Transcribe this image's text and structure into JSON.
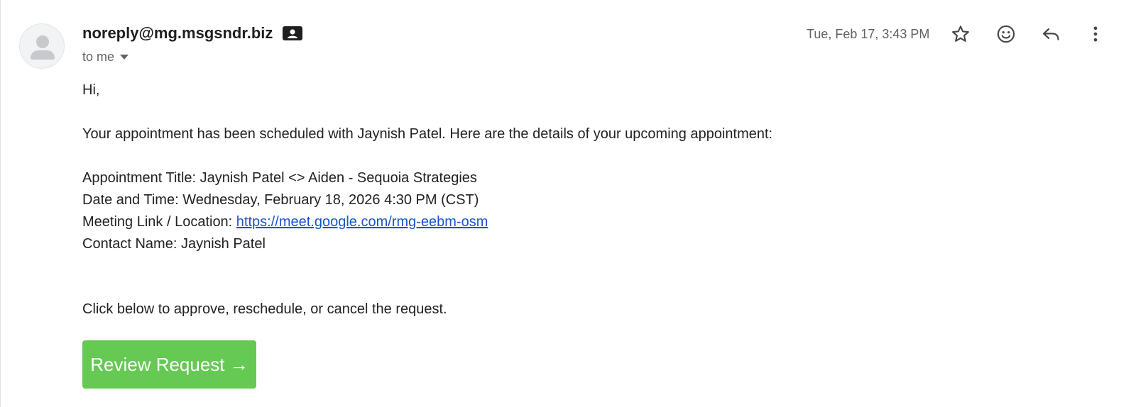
{
  "sender": {
    "email": "noreply@mg.msgsndr.biz",
    "contact_icon": "contact-card-icon"
  },
  "recipient": {
    "label": "to me",
    "dropdown_icon": "chevron-down-icon"
  },
  "header": {
    "timestamp": "Tue, Feb 17, 3:43 PM",
    "icons": [
      "star-icon",
      "emoji-icon",
      "reply-icon",
      "more-vert-icon"
    ]
  },
  "message": {
    "greeting": "Hi,",
    "intro": "Your appointment has been scheduled with Jaynish Patel. Here are the details of your upcoming appointment:",
    "details": {
      "title_label": "Appointment Title: ",
      "title_value": "Jaynish Patel <> Aiden - Sequoia Strategies",
      "datetime_label": "Date and Time: ",
      "datetime_value": "Wednesday, February 18, 2026 4:30 PM (CST)",
      "location_label": "Meeting Link / Location: ",
      "location_link": "https://meet.google.com/rmg-eebm-osm",
      "contact_label": "Contact Name: ",
      "contact_value": "Jaynish Patel"
    },
    "instruction": "Click below to approve, reschedule, or cancel the request.",
    "cta_label": "Review Request →"
  },
  "colors": {
    "cta_background": "#65c953",
    "link": "#1a56c9",
    "muted_text": "#5f6368"
  }
}
